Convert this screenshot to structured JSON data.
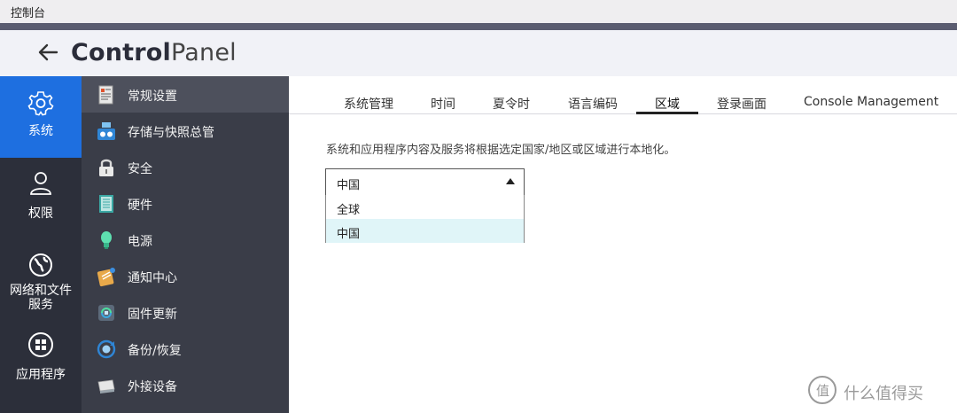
{
  "window": {
    "title": "控制台"
  },
  "header": {
    "title_bold": "Control",
    "title_light": "Panel"
  },
  "nav": {
    "items": [
      {
        "label": "系统",
        "icon": "gear-icon",
        "active": true
      },
      {
        "label": "权限",
        "icon": "user-icon"
      },
      {
        "label_line1": "网络和文件",
        "label_line2": "服务",
        "icon": "globe-icon"
      },
      {
        "label": "应用程序",
        "icon": "apps-grid-icon"
      }
    ]
  },
  "submenu": {
    "items": [
      {
        "label": "常规设置",
        "icon": "settings-doc-icon",
        "active": true
      },
      {
        "label": "存储与快照总管",
        "icon": "storage-icon"
      },
      {
        "label": "安全",
        "icon": "lock-icon"
      },
      {
        "label": "硬件",
        "icon": "hardware-icon"
      },
      {
        "label": "电源",
        "icon": "power-bulb-icon"
      },
      {
        "label": "通知中心",
        "icon": "notification-icon"
      },
      {
        "label": "固件更新",
        "icon": "firmware-update-icon"
      },
      {
        "label": "备份/恢复",
        "icon": "backup-icon"
      },
      {
        "label": "外接设备",
        "icon": "external-device-icon"
      }
    ]
  },
  "tabs": [
    {
      "label": "系统管理"
    },
    {
      "label": "时间"
    },
    {
      "label": "夏令时"
    },
    {
      "label": "语言编码"
    },
    {
      "label": "区域",
      "active": true
    },
    {
      "label": "登录画面"
    },
    {
      "label": "Console Management"
    }
  ],
  "region": {
    "description": "系统和应用程序内容及服务将根据选定国家/地区或区域进行本地化。",
    "selected": "中国",
    "options": [
      {
        "label": "全球"
      },
      {
        "label": "中国",
        "selected": true
      }
    ]
  },
  "watermark": {
    "mark": "值",
    "text": "什么值得买"
  },
  "colors": {
    "accent": "#1e6fe0",
    "nav_bg": "#2c2f3a",
    "submenu_bg": "#3a3d48",
    "option_highlight": "#e0f5f8"
  }
}
